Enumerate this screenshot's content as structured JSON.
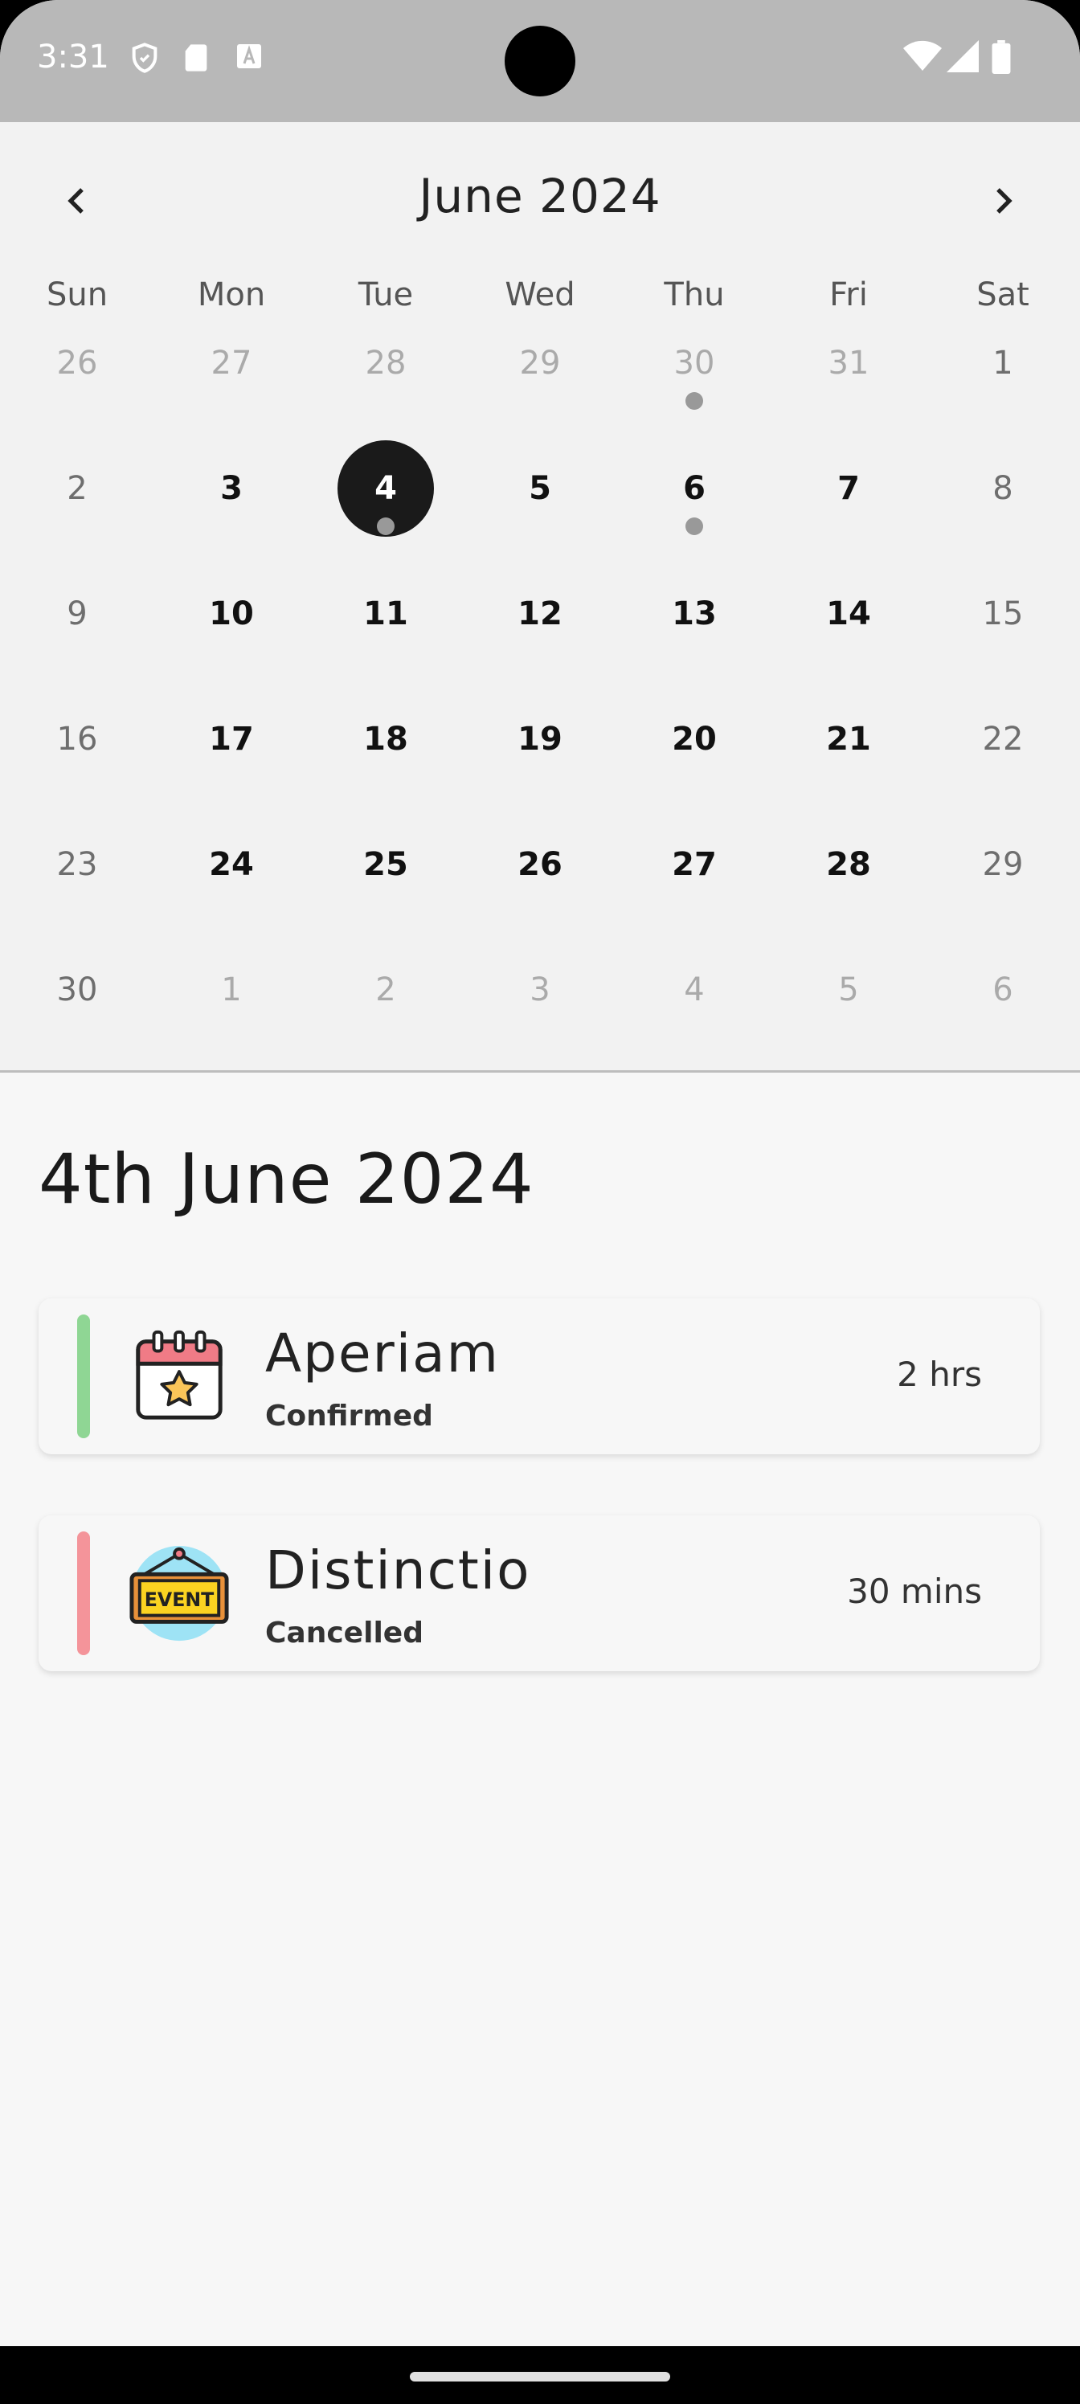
{
  "status_bar": {
    "time": "3:31"
  },
  "calendar": {
    "month_title": "June 2024",
    "weekdays": [
      "Sun",
      "Mon",
      "Tue",
      "Wed",
      "Thu",
      "Fri",
      "Sat"
    ],
    "weeks": [
      [
        "26",
        "27",
        "28",
        "29",
        "30",
        "31",
        "1"
      ],
      [
        "2",
        "3",
        "4",
        "5",
        "6",
        "7",
        "8"
      ],
      [
        "9",
        "10",
        "11",
        "12",
        "13",
        "14",
        "15"
      ],
      [
        "16",
        "17",
        "18",
        "19",
        "20",
        "21",
        "22"
      ],
      [
        "23",
        "24",
        "25",
        "26",
        "27",
        "28",
        "29"
      ],
      [
        "30",
        "1",
        "2",
        "3",
        "4",
        "5",
        "6"
      ]
    ],
    "selected_date": "4"
  },
  "agenda": {
    "heading": "4th June 2024",
    "events": [
      {
        "title": "Aperiam",
        "status": "Confirmed",
        "duration": "2 hrs",
        "accent": "#8fd694",
        "icon": "calendar-star-icon"
      },
      {
        "title": "Distinctio",
        "status": "Cancelled",
        "duration": "30 mins",
        "accent": "#f4949a",
        "icon": "event-sign-icon"
      }
    ]
  },
  "colors": {
    "status_bar": "#b8b8b8",
    "selected_day": "#1a1a1a",
    "event_dot": "#999999"
  }
}
